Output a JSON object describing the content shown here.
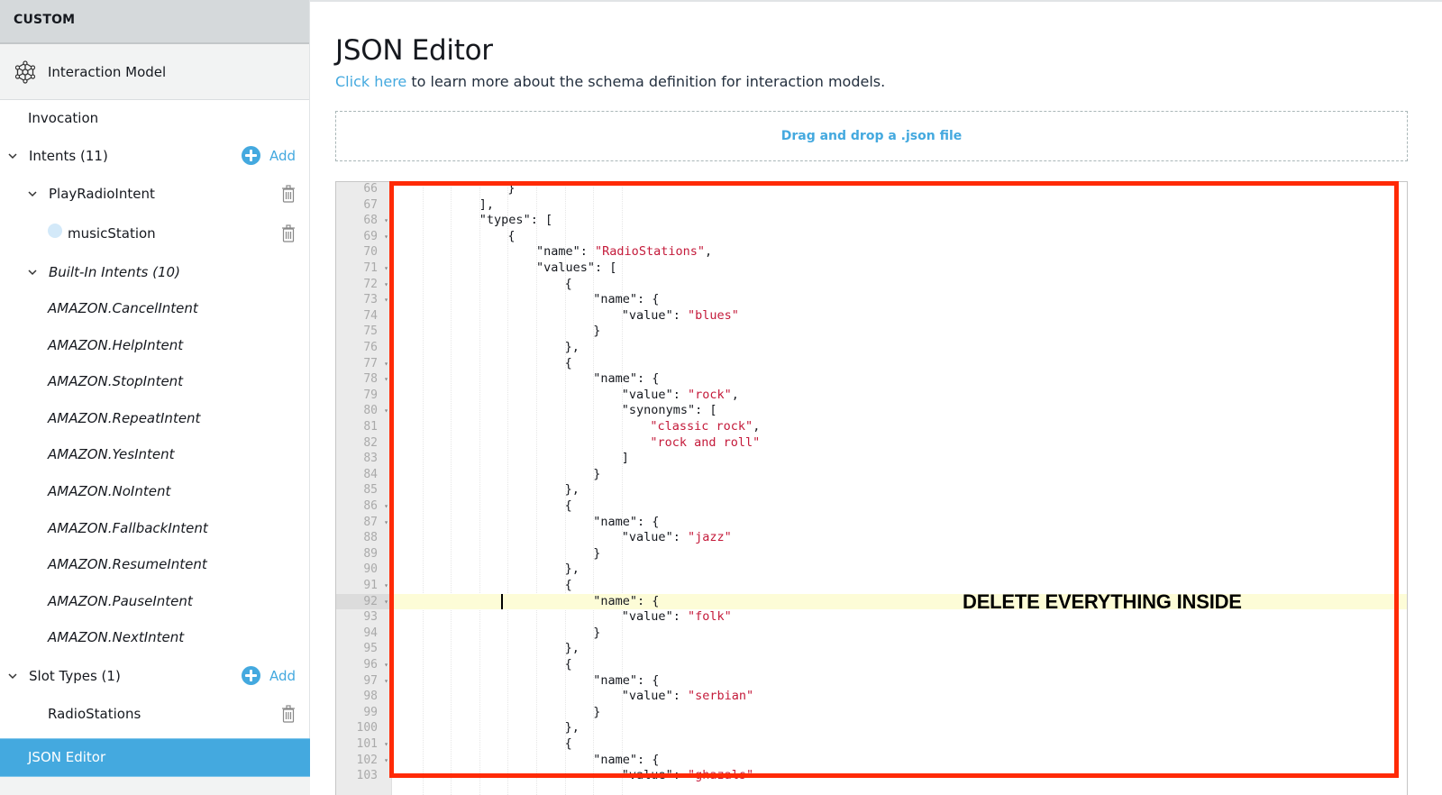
{
  "sidebar": {
    "section_header": "CUSTOM",
    "model": {
      "label": "Interaction Model",
      "icon": "interaction-model-icon"
    },
    "invocation": "Invocation",
    "intents": {
      "label": "Intents (11)",
      "add_label": "Add"
    },
    "custom_intent": {
      "label": "PlayRadioIntent"
    },
    "slot": {
      "label": "musicStation"
    },
    "builtin": {
      "label": "Built-In Intents (10)",
      "items": [
        "AMAZON.CancelIntent",
        "AMAZON.HelpIntent",
        "AMAZON.StopIntent",
        "AMAZON.RepeatIntent",
        "AMAZON.YesIntent",
        "AMAZON.NoIntent",
        "AMAZON.FallbackIntent",
        "AMAZON.ResumeIntent",
        "AMAZON.PauseIntent",
        "AMAZON.NextIntent"
      ]
    },
    "slot_types": {
      "label": "Slot Types (1)",
      "add_label": "Add",
      "items": [
        "RadioStations"
      ]
    },
    "active_item": "JSON Editor"
  },
  "main": {
    "title": "JSON Editor",
    "link_text": "Click here",
    "subtitle_rest": " to learn more about the schema definition for interaction models.",
    "dropzone_label": "Drag and drop a .json file"
  },
  "editor": {
    "active_line": 92,
    "lines": [
      {
        "n": 66,
        "indent": 4,
        "fold": false,
        "tokens": [
          [
            "punc",
            "}"
          ]
        ]
      },
      {
        "n": 67,
        "indent": 3,
        "fold": false,
        "tokens": [
          [
            "punc",
            "],"
          ]
        ]
      },
      {
        "n": 68,
        "indent": 3,
        "fold": true,
        "tokens": [
          [
            "key",
            "\"types\""
          ],
          [
            "punc",
            ": ["
          ]
        ]
      },
      {
        "n": 69,
        "indent": 4,
        "fold": true,
        "tokens": [
          [
            "punc",
            "{"
          ]
        ]
      },
      {
        "n": 70,
        "indent": 5,
        "fold": false,
        "tokens": [
          [
            "key",
            "\"name\""
          ],
          [
            "punc",
            ": "
          ],
          [
            "str",
            "\"RadioStations\""
          ],
          [
            "punc",
            ","
          ]
        ]
      },
      {
        "n": 71,
        "indent": 5,
        "fold": true,
        "tokens": [
          [
            "key",
            "\"values\""
          ],
          [
            "punc",
            ": ["
          ]
        ]
      },
      {
        "n": 72,
        "indent": 6,
        "fold": true,
        "tokens": [
          [
            "punc",
            "{"
          ]
        ]
      },
      {
        "n": 73,
        "indent": 7,
        "fold": true,
        "tokens": [
          [
            "key",
            "\"name\""
          ],
          [
            "punc",
            ": {"
          ]
        ]
      },
      {
        "n": 74,
        "indent": 8,
        "fold": false,
        "tokens": [
          [
            "key",
            "\"value\""
          ],
          [
            "punc",
            ": "
          ],
          [
            "str",
            "\"blues\""
          ]
        ]
      },
      {
        "n": 75,
        "indent": 7,
        "fold": false,
        "tokens": [
          [
            "punc",
            "}"
          ]
        ]
      },
      {
        "n": 76,
        "indent": 6,
        "fold": false,
        "tokens": [
          [
            "punc",
            "},"
          ]
        ]
      },
      {
        "n": 77,
        "indent": 6,
        "fold": true,
        "tokens": [
          [
            "punc",
            "{"
          ]
        ]
      },
      {
        "n": 78,
        "indent": 7,
        "fold": true,
        "tokens": [
          [
            "key",
            "\"name\""
          ],
          [
            "punc",
            ": {"
          ]
        ]
      },
      {
        "n": 79,
        "indent": 8,
        "fold": false,
        "tokens": [
          [
            "key",
            "\"value\""
          ],
          [
            "punc",
            ": "
          ],
          [
            "str",
            "\"rock\""
          ],
          [
            "punc",
            ","
          ]
        ]
      },
      {
        "n": 80,
        "indent": 8,
        "fold": true,
        "tokens": [
          [
            "key",
            "\"synonyms\""
          ],
          [
            "punc",
            ": ["
          ]
        ]
      },
      {
        "n": 81,
        "indent": 9,
        "fold": false,
        "tokens": [
          [
            "str",
            "\"classic rock\""
          ],
          [
            "punc",
            ","
          ]
        ]
      },
      {
        "n": 82,
        "indent": 9,
        "fold": false,
        "tokens": [
          [
            "str",
            "\"rock and roll\""
          ]
        ]
      },
      {
        "n": 83,
        "indent": 8,
        "fold": false,
        "tokens": [
          [
            "punc",
            "]"
          ]
        ]
      },
      {
        "n": 84,
        "indent": 7,
        "fold": false,
        "tokens": [
          [
            "punc",
            "}"
          ]
        ]
      },
      {
        "n": 85,
        "indent": 6,
        "fold": false,
        "tokens": [
          [
            "punc",
            "},"
          ]
        ]
      },
      {
        "n": 86,
        "indent": 6,
        "fold": true,
        "tokens": [
          [
            "punc",
            "{"
          ]
        ]
      },
      {
        "n": 87,
        "indent": 7,
        "fold": true,
        "tokens": [
          [
            "key",
            "\"name\""
          ],
          [
            "punc",
            ": {"
          ]
        ]
      },
      {
        "n": 88,
        "indent": 8,
        "fold": false,
        "tokens": [
          [
            "key",
            "\"value\""
          ],
          [
            "punc",
            ": "
          ],
          [
            "str",
            "\"jazz\""
          ]
        ]
      },
      {
        "n": 89,
        "indent": 7,
        "fold": false,
        "tokens": [
          [
            "punc",
            "}"
          ]
        ]
      },
      {
        "n": 90,
        "indent": 6,
        "fold": false,
        "tokens": [
          [
            "punc",
            "},"
          ]
        ]
      },
      {
        "n": 91,
        "indent": 6,
        "fold": true,
        "tokens": [
          [
            "punc",
            "{"
          ]
        ]
      },
      {
        "n": 92,
        "indent": 7,
        "fold": true,
        "tokens": [
          [
            "key",
            "\"name\""
          ],
          [
            "punc",
            ": {"
          ]
        ]
      },
      {
        "n": 93,
        "indent": 8,
        "fold": false,
        "tokens": [
          [
            "key",
            "\"value\""
          ],
          [
            "punc",
            ": "
          ],
          [
            "str",
            "\"folk\""
          ]
        ]
      },
      {
        "n": 94,
        "indent": 7,
        "fold": false,
        "tokens": [
          [
            "punc",
            "}"
          ]
        ]
      },
      {
        "n": 95,
        "indent": 6,
        "fold": false,
        "tokens": [
          [
            "punc",
            "},"
          ]
        ]
      },
      {
        "n": 96,
        "indent": 6,
        "fold": true,
        "tokens": [
          [
            "punc",
            "{"
          ]
        ]
      },
      {
        "n": 97,
        "indent": 7,
        "fold": true,
        "tokens": [
          [
            "key",
            "\"name\""
          ],
          [
            "punc",
            ": {"
          ]
        ]
      },
      {
        "n": 98,
        "indent": 8,
        "fold": false,
        "tokens": [
          [
            "key",
            "\"value\""
          ],
          [
            "punc",
            ": "
          ],
          [
            "str",
            "\"serbian\""
          ]
        ]
      },
      {
        "n": 99,
        "indent": 7,
        "fold": false,
        "tokens": [
          [
            "punc",
            "}"
          ]
        ]
      },
      {
        "n": 100,
        "indent": 6,
        "fold": false,
        "tokens": [
          [
            "punc",
            "},"
          ]
        ]
      },
      {
        "n": 101,
        "indent": 6,
        "fold": true,
        "tokens": [
          [
            "punc",
            "{"
          ]
        ]
      },
      {
        "n": 102,
        "indent": 7,
        "fold": true,
        "tokens": [
          [
            "key",
            "\"name\""
          ],
          [
            "punc",
            ": {"
          ]
        ]
      },
      {
        "n": 103,
        "indent": 8,
        "fold": false,
        "tokens": [
          [
            "key",
            "\"value\""
          ],
          [
            "punc",
            ": "
          ],
          [
            "str",
            "\"ghazals\""
          ]
        ]
      }
    ]
  },
  "annotation": {
    "text": "DELETE EVERYTHING INSIDE",
    "color": "#ff2a06"
  },
  "colors": {
    "accent": "#44a9df",
    "string": "#c41a3a",
    "active_line": "#fdfcd7"
  }
}
